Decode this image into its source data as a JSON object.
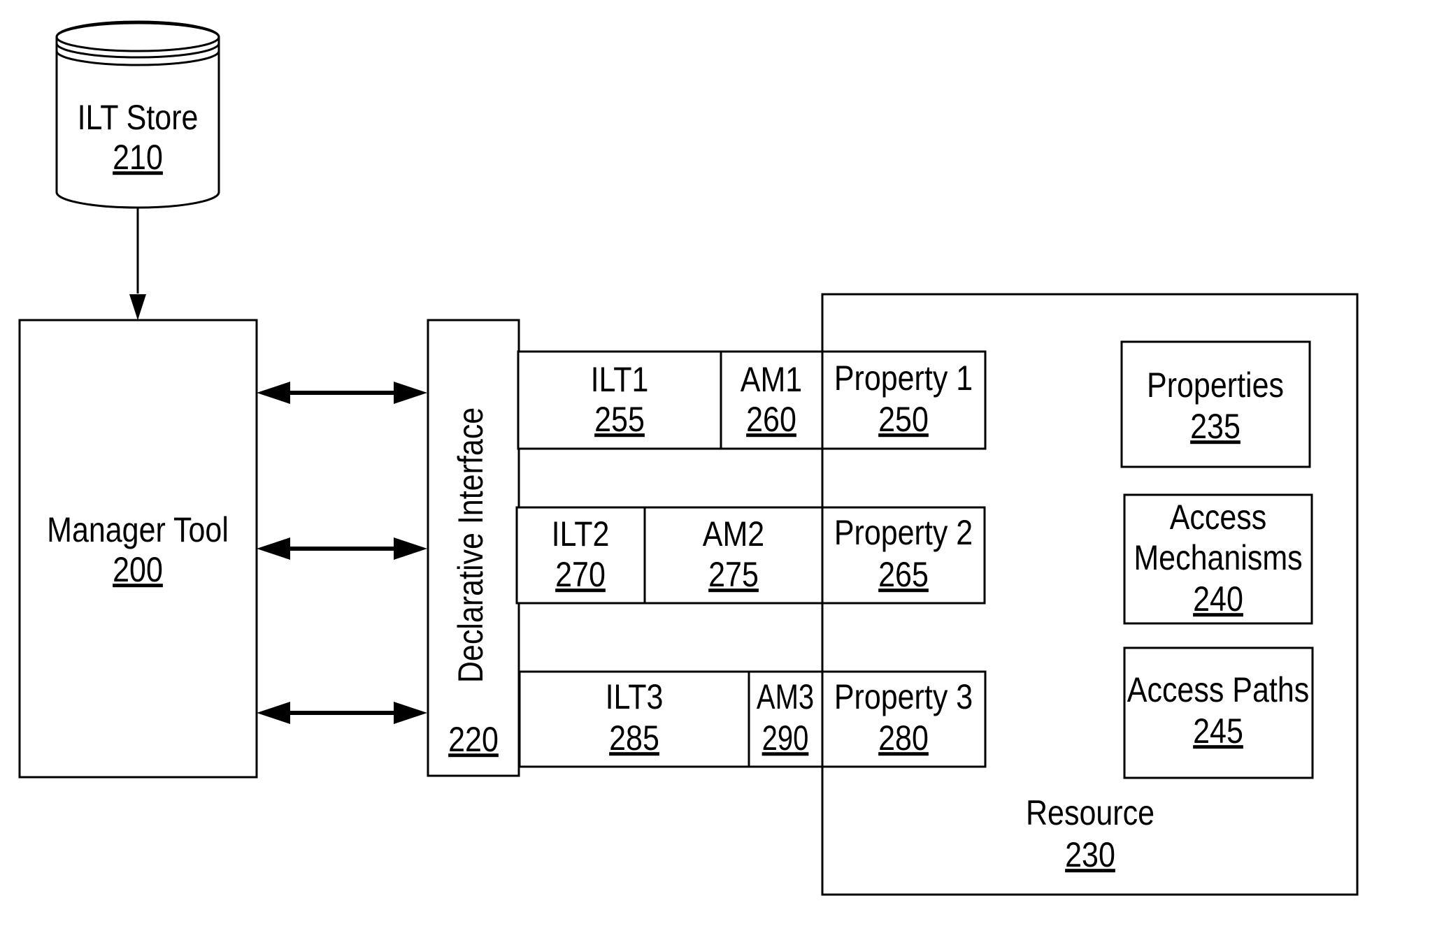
{
  "diagram": {
    "ilt_store": {
      "label": "ILT Store",
      "ref": "210"
    },
    "manager_tool": {
      "label": "Manager Tool",
      "ref": "200"
    },
    "declarative_interface": {
      "label": "Declarative Interface",
      "ref": "220"
    },
    "rows": [
      {
        "ilt": {
          "label": "ILT1",
          "ref": "255"
        },
        "am": {
          "label": "AM1",
          "ref": "260"
        },
        "property": {
          "label": "Property 1",
          "ref": "250"
        }
      },
      {
        "ilt": {
          "label": "ILT2",
          "ref": "270"
        },
        "am": {
          "label": "AM2",
          "ref": "275"
        },
        "property": {
          "label": "Property 2",
          "ref": "265"
        }
      },
      {
        "ilt": {
          "label": "ILT3",
          "ref": "285"
        },
        "am": {
          "label": "AM3",
          "ref": "290"
        },
        "property": {
          "label": "Property 3",
          "ref": "280"
        }
      }
    ],
    "resource": {
      "label": "Resource",
      "ref": "230",
      "components": [
        {
          "label_lines": [
            "Properties"
          ],
          "ref": "235"
        },
        {
          "label_lines": [
            "Access",
            "Mechanisms"
          ],
          "ref": "240"
        },
        {
          "label_lines": [
            "Access Paths"
          ],
          "ref": "245"
        }
      ]
    },
    "connections": [
      {
        "from": "ILT Store 210",
        "to": "Manager Tool 200",
        "type": "one-way-arrow"
      },
      {
        "from": "Manager Tool 200",
        "to": "Declarative Interface 220",
        "type": "two-way-arrow"
      },
      {
        "from": "Manager Tool 200",
        "to": "Declarative Interface 220",
        "type": "two-way-arrow"
      },
      {
        "from": "Manager Tool 200",
        "to": "Declarative Interface 220",
        "type": "two-way-arrow"
      }
    ]
  }
}
